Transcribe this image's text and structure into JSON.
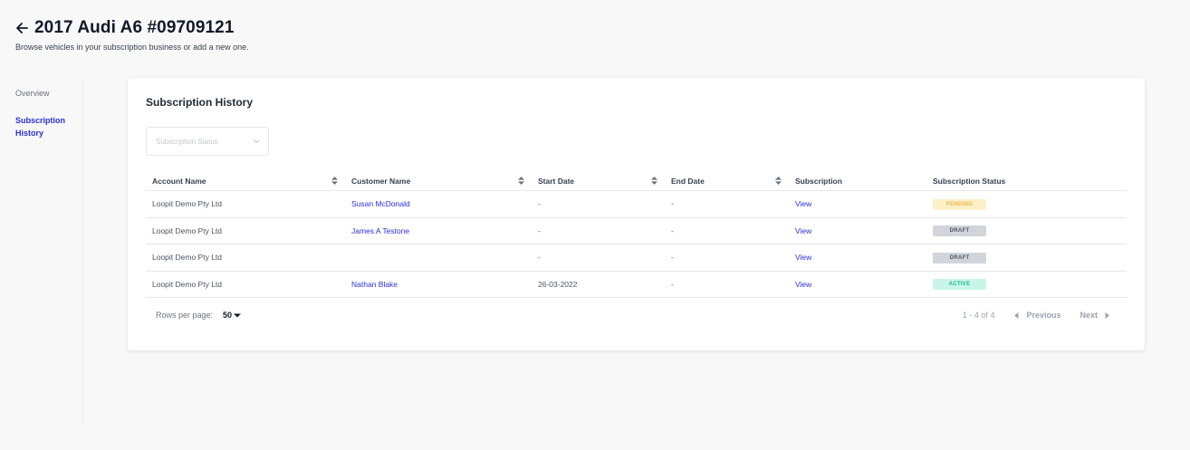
{
  "header": {
    "title": "2017 Audi A6 #09709121",
    "subtitle": "Browse vehicles in your subscription business or add a new one."
  },
  "nav": {
    "items": [
      {
        "label": "Overview",
        "active": false
      },
      {
        "label_line1": "Subscription",
        "label_line2": "History",
        "active": true
      }
    ]
  },
  "card": {
    "title": "Subscription History",
    "filter": {
      "placeholder": "Subscription Status"
    }
  },
  "table": {
    "columns": [
      {
        "label": "Account Name",
        "sortable": true
      },
      {
        "label": "Customer Name",
        "sortable": true
      },
      {
        "label": "Start Date",
        "sortable": true
      },
      {
        "label": "End Date",
        "sortable": true
      },
      {
        "label": "Subscription",
        "sortable": false
      },
      {
        "label": "Subscription Status",
        "sortable": false
      }
    ],
    "rows": [
      {
        "account": "Loopit Demo Pty Ltd",
        "customer": "Susan McDonald",
        "start": "-",
        "end": "-",
        "subscription": "View",
        "status": "PENDING"
      },
      {
        "account": "Loopit Demo Pty Ltd",
        "customer": "James A Testone",
        "start": "-",
        "end": "-",
        "subscription": "View",
        "status": "DRAFT"
      },
      {
        "account": "Loopit Demo Pty Ltd",
        "customer": "",
        "start": "-",
        "end": "-",
        "subscription": "View",
        "status": "DRAFT"
      },
      {
        "account": "Loopit Demo Pty Ltd",
        "customer": "Nathan Blake",
        "start": "26-03-2022",
        "end": "-",
        "subscription": "View",
        "status": "ACTIVE"
      }
    ]
  },
  "status_colors": {
    "PENDING": {
      "bg": "#fdf0c7",
      "fg": "#e8b94a"
    },
    "DRAFT": {
      "bg": "#d1d5db",
      "fg": "#4b5563"
    },
    "ACTIVE": {
      "bg": "#c9f5e8",
      "fg": "#1fb889"
    }
  },
  "pagination": {
    "rows_per_page_label": "Rows per page:",
    "rows_per_page_value": "50",
    "range": "1 - 4 of 4",
    "previous": "Previous",
    "next": "Next"
  },
  "colors": {
    "accent": "#2b2fd6",
    "background": "#f8f8f9"
  }
}
